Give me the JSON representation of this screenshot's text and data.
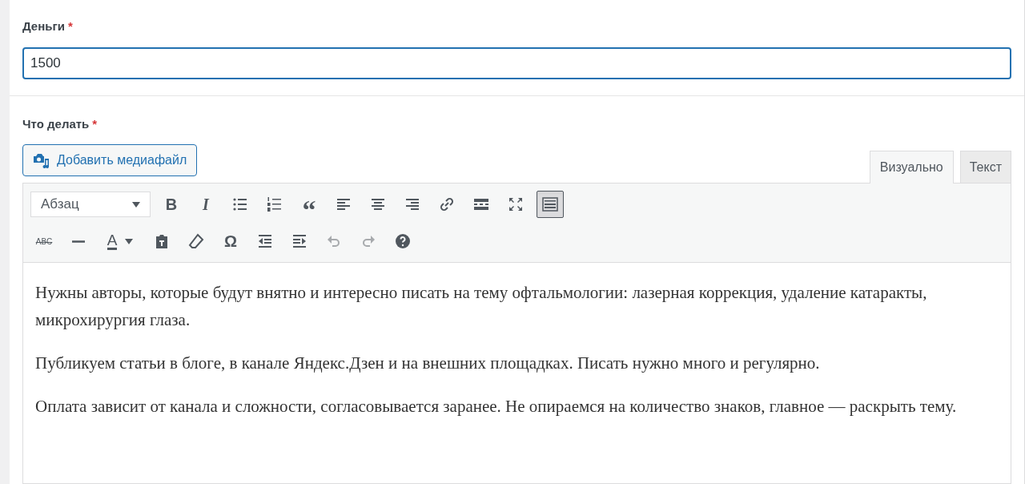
{
  "money_field": {
    "label": "Деньги",
    "required_mark": "*",
    "value": "1500",
    "focused": true
  },
  "task_field": {
    "label": "Что делать",
    "required_mark": "*"
  },
  "media_button": {
    "label": "Добавить медиафайл"
  },
  "editor_tabs": [
    {
      "label": "Визуально",
      "selected": true
    },
    {
      "label": "Текст",
      "selected": false
    }
  ],
  "format_select": {
    "value": "Абзац"
  },
  "toolbar_rows": [
    [
      {
        "kind": "bold",
        "glyph": "B",
        "pressed": false,
        "disabled": false
      },
      {
        "kind": "italic",
        "glyph": "I",
        "pressed": false,
        "disabled": false
      },
      {
        "kind": "bullet-list",
        "pressed": false,
        "disabled": false
      },
      {
        "kind": "numbered-list",
        "pressed": false,
        "disabled": false
      },
      {
        "kind": "quote",
        "glyph": "“",
        "pressed": false,
        "disabled": false
      },
      {
        "kind": "align-left",
        "pressed": false,
        "disabled": false
      },
      {
        "kind": "align-center",
        "pressed": false,
        "disabled": false
      },
      {
        "kind": "align-right",
        "pressed": false,
        "disabled": false
      },
      {
        "kind": "link",
        "pressed": false,
        "disabled": false
      },
      {
        "kind": "read-more",
        "pressed": false,
        "disabled": false
      },
      {
        "kind": "fullscreen",
        "pressed": false,
        "disabled": false
      },
      {
        "kind": "toolbar-toggle",
        "pressed": true,
        "disabled": false
      }
    ],
    [
      {
        "kind": "strikethrough",
        "glyph": "ABC",
        "pressed": false,
        "disabled": false
      },
      {
        "kind": "horizontal-line",
        "pressed": false,
        "disabled": false
      },
      {
        "kind": "text-color",
        "glyph": "A",
        "pressed": false,
        "disabled": false
      },
      {
        "kind": "paste-text",
        "pressed": false,
        "disabled": false
      },
      {
        "kind": "eraser",
        "pressed": false,
        "disabled": false
      },
      {
        "kind": "special-char",
        "glyph": "Ω",
        "pressed": false,
        "disabled": false
      },
      {
        "kind": "outdent",
        "pressed": false,
        "disabled": false
      },
      {
        "kind": "indent",
        "pressed": false,
        "disabled": false
      },
      {
        "kind": "undo",
        "pressed": false,
        "disabled": true
      },
      {
        "kind": "redo",
        "pressed": false,
        "disabled": true
      },
      {
        "kind": "help",
        "pressed": false,
        "disabled": false
      }
    ]
  ],
  "content": [
    "Нужны авторы, которые будут внятно и интересно писать на тему офтальмологии: лазерная коррекция, удаление катаракты, микрохирургия глаза.",
    "Публикуем статьи в блоге, в канале Яндекс.Дзен и на внешних площадках. Писать нужно много и регулярно.",
    "Оплата зависит от канала и сложности, согласовывается заранее. Не опираемся на количество знаков, главное — раскрыть тему."
  ]
}
